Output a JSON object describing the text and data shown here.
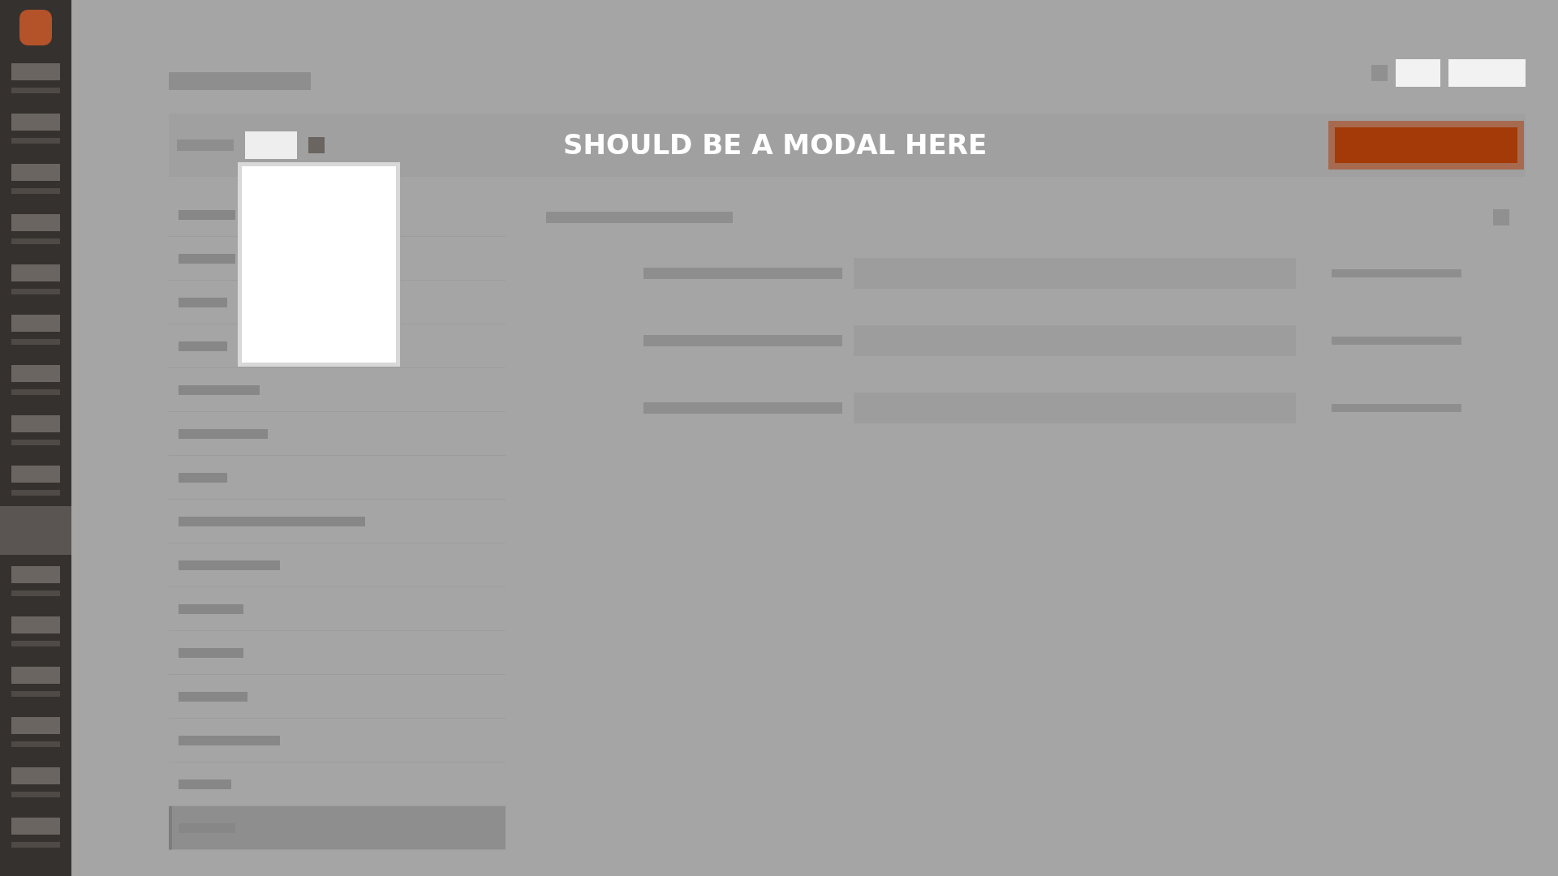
{
  "overlay": {
    "caption": "SHOULD BE A MODAL HERE"
  },
  "sidebar": {
    "items": [
      {
        "selected": false
      },
      {
        "selected": false
      },
      {
        "selected": false
      },
      {
        "selected": false
      },
      {
        "selected": false
      },
      {
        "selected": false
      },
      {
        "selected": false
      },
      {
        "selected": false
      },
      {
        "selected": false
      },
      {
        "selected": true
      },
      {
        "selected": false
      },
      {
        "selected": false
      },
      {
        "selected": false
      },
      {
        "selected": false
      },
      {
        "selected": false
      },
      {
        "selected": false
      }
    ]
  },
  "list": {
    "items": [
      {
        "selected": false
      },
      {
        "selected": false
      },
      {
        "selected": false
      },
      {
        "selected": false
      },
      {
        "selected": false
      },
      {
        "selected": false
      },
      {
        "selected": false
      },
      {
        "selected": false
      },
      {
        "selected": false
      },
      {
        "selected": false
      },
      {
        "selected": false
      },
      {
        "selected": false
      },
      {
        "selected": false
      },
      {
        "selected": false
      },
      {
        "selected": true
      }
    ]
  }
}
